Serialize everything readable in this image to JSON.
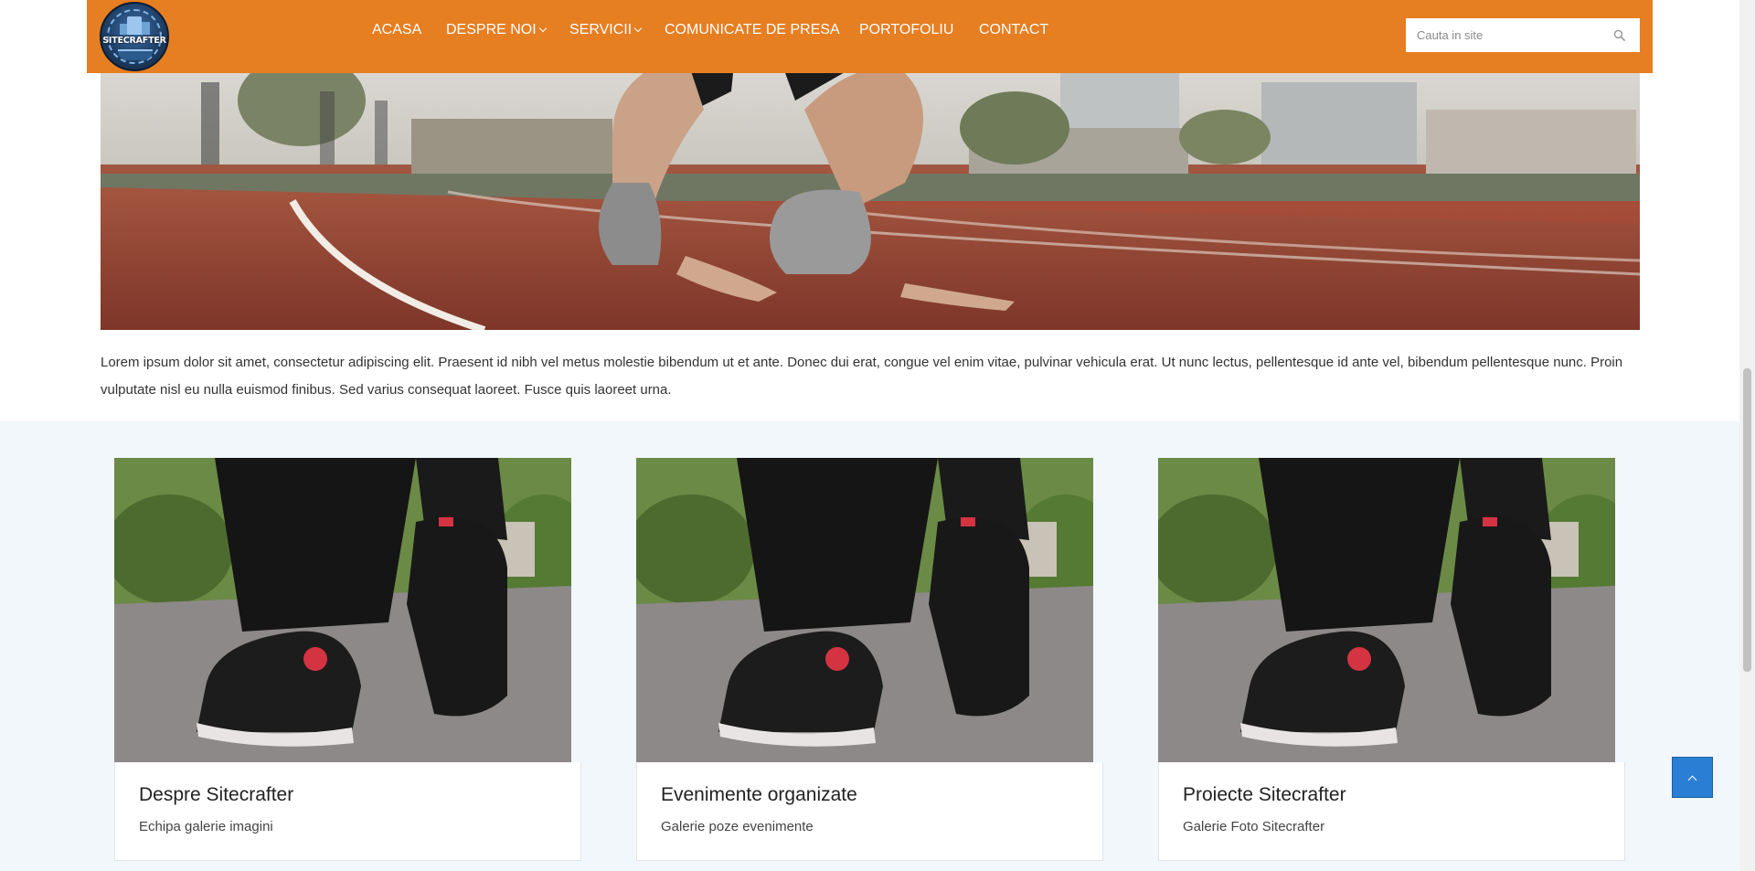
{
  "header": {
    "logo_text": "SITECRAFTER",
    "nav": [
      {
        "label": "ACASA",
        "dropdown": false
      },
      {
        "label": "DESPRE NOI",
        "dropdown": true
      },
      {
        "label": "SERVICII",
        "dropdown": true
      },
      {
        "label": "COMUNICATE DE PRESA",
        "dropdown": false
      },
      {
        "label": "PORTOFOLIU",
        "dropdown": false
      },
      {
        "label": "CONTACT",
        "dropdown": false
      }
    ],
    "search": {
      "placeholder": "Cauta in site",
      "value": "",
      "icon": "search-icon"
    },
    "background_color": "#e67e22"
  },
  "hero": {
    "image": "runner-starting-position-on-track-photo"
  },
  "intro_paragraph": "Lorem ipsum dolor sit amet, consectetur adipiscing elit. Praesent id nibh vel metus molestie bibendum ut et ante. Donec dui erat, congue vel enim vitae, pulvinar vehicula erat. Ut nunc lectus, pellentesque id ante vel, bibendum pellentesque nunc. Proin vulputate nisl eu nulla euismod finibus. Sed varius consequat laoreet. Fusce quis laoreet urna.",
  "gallery": {
    "cards": [
      {
        "title": "Despre Sitecrafter",
        "subtitle": "Echipa galerie imagini",
        "image": "sneakers-walking-photo"
      },
      {
        "title": "Evenimente organizate",
        "subtitle": "Galerie poze evenimente",
        "image": "sneakers-walking-photo"
      },
      {
        "title": "Proiecte Sitecrafter",
        "subtitle": "Galerie Foto Sitecrafter",
        "image": "sneakers-walking-photo"
      }
    ],
    "background_color": "#f1f7fb"
  },
  "back_to_top": {
    "icon": "chevron-up-icon",
    "color": "#2a7fd4"
  }
}
